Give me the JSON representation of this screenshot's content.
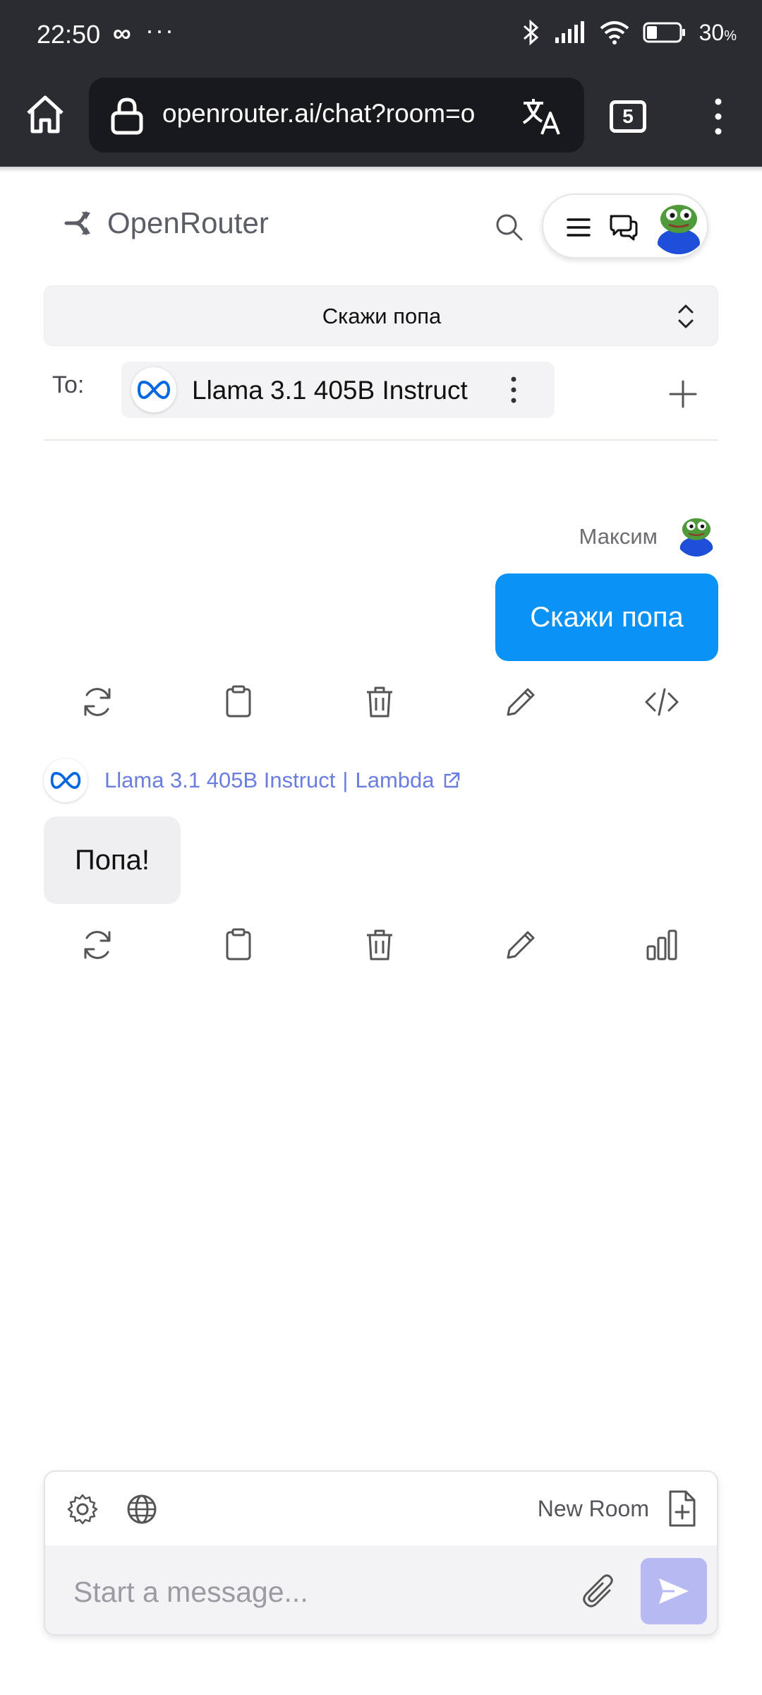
{
  "status_bar": {
    "time": "22:50",
    "loop_glyph": "∞",
    "more_glyph": "···",
    "battery_percent": "30",
    "battery_unit": "%"
  },
  "browser": {
    "url": "openrouter.ai/chat?room=o",
    "tab_count": "5"
  },
  "header": {
    "logo_text": "OpenRouter"
  },
  "room": {
    "title": "Скажи попа"
  },
  "to": {
    "label": "To:",
    "model_name": "Llama 3.1 405B Instruct"
  },
  "messages": {
    "user": {
      "name": "Максим",
      "text": "Скажи попа"
    },
    "assistant": {
      "model": "Llama 3.1 405B Instruct",
      "separator": "|",
      "provider": "Lambda",
      "text": "Попа!"
    }
  },
  "composer": {
    "new_room_label": "New Room",
    "placeholder": "Start a message..."
  },
  "colors": {
    "chrome_bg": "#2b2c31",
    "url_box": "#18191d",
    "user_bubble": "#0a93f5",
    "assistant_bubble": "#efeff2",
    "meta_blue": "#0668e1",
    "model_link": "#6b7ee0",
    "send_button": "#b7b9f3"
  },
  "icons": {
    "home": "home-icon",
    "lock": "lock-icon",
    "translate": "translate-icon",
    "menu": "kebab-menu-icon",
    "search": "search-icon",
    "hamburger": "hamburger-icon",
    "chat": "chat-bubbles-icon",
    "regenerate": "refresh-icon",
    "copy": "clipboard-icon",
    "delete": "trash-icon",
    "edit": "pencil-icon",
    "code": "code-icon",
    "stats": "bar-chart-icon",
    "settings": "gear-icon",
    "web": "globe-icon",
    "new_file": "file-plus-icon",
    "attach": "paperclip-icon",
    "send": "send-icon"
  }
}
